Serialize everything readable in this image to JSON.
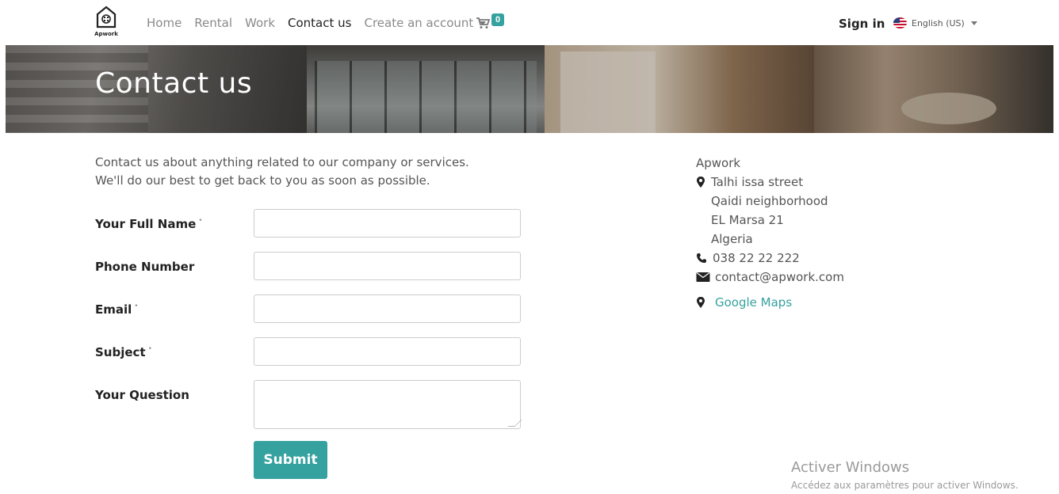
{
  "brand": {
    "logo_text": "Apwork"
  },
  "nav": {
    "home": "Home",
    "rental": "Rental",
    "work": "Work",
    "contact": "Contact us",
    "create_account": "Create an account",
    "cart_count": "0"
  },
  "header_right": {
    "sign_in": "Sign in",
    "language": "English (US)"
  },
  "banner": {
    "title": "Contact us"
  },
  "intro": {
    "line1": "Contact us about anything related to our company or services.",
    "line2": "We'll do our best to get back to you as soon as possible."
  },
  "form": {
    "required_marker": "•",
    "fields": [
      {
        "label": "Your Full Name",
        "required": true,
        "value": ""
      },
      {
        "label": "Phone Number",
        "required": false,
        "value": ""
      },
      {
        "label": "Email",
        "required": true,
        "value": ""
      },
      {
        "label": "Subject",
        "required": true,
        "value": ""
      },
      {
        "label": "Your Question",
        "required": false,
        "value": ""
      }
    ],
    "submit": "Submit"
  },
  "address": {
    "company": "Apwork",
    "street": "Talhi issa street",
    "neighborhood": "Qaidi neighborhood",
    "city": "EL Marsa 21",
    "country": "Algeria",
    "phone": "038 22 22 222",
    "email": "contact@apwork.com",
    "maps_link": "Google Maps"
  },
  "watermark": {
    "title": "Activer Windows",
    "subtitle": "Accédez aux paramètres pour activer Windows."
  },
  "colors": {
    "accent": "#35a29f"
  }
}
